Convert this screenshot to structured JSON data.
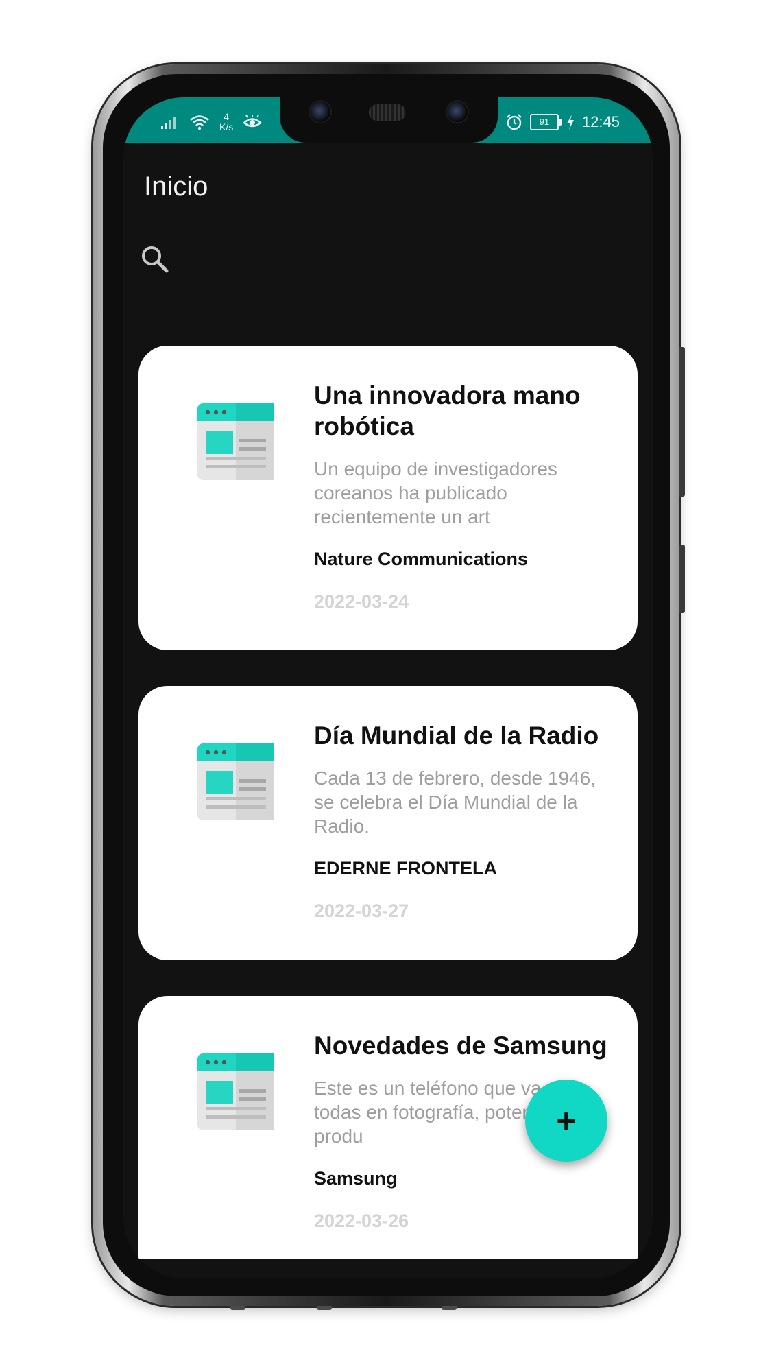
{
  "status_bar": {
    "network_speed_value": "4",
    "network_speed_unit": "K/s",
    "battery": "91",
    "time": "12:45",
    "icons": [
      "signal-icon",
      "wifi-icon",
      "eye-icon",
      "alarm-icon",
      "battery-icon",
      "charging-icon"
    ]
  },
  "app_bar": {
    "title": "Inicio",
    "search_icon": "search-icon"
  },
  "articles": [
    {
      "title": "Una innovadora mano robótica",
      "summary": "Un equipo de investigadores coreanos ha publicado recientemente un art",
      "author": "Nature Communications",
      "date": "2022-03-24"
    },
    {
      "title": "Día Mundial de la Radio",
      "summary": "Cada 13 de febrero, desde 1946, se celebra el Día Mundial de la Radio.",
      "author": "EDERNE FRONTELA",
      "date": "2022-03-27"
    },
    {
      "title": "Novedades de Samsung",
      "summary": "Este es un teléfono que va por todas en fotografía, potencia y produ",
      "author": "Samsung",
      "date": "2022-03-26"
    }
  ],
  "fab": {
    "label": "+"
  },
  "colors": {
    "status_bar": "#00897f",
    "background": "#121212",
    "card": "#ffffff",
    "accent": "#10d8c4",
    "summary_text": "#9e9e9e",
    "date_text": "#d4d4d4"
  }
}
